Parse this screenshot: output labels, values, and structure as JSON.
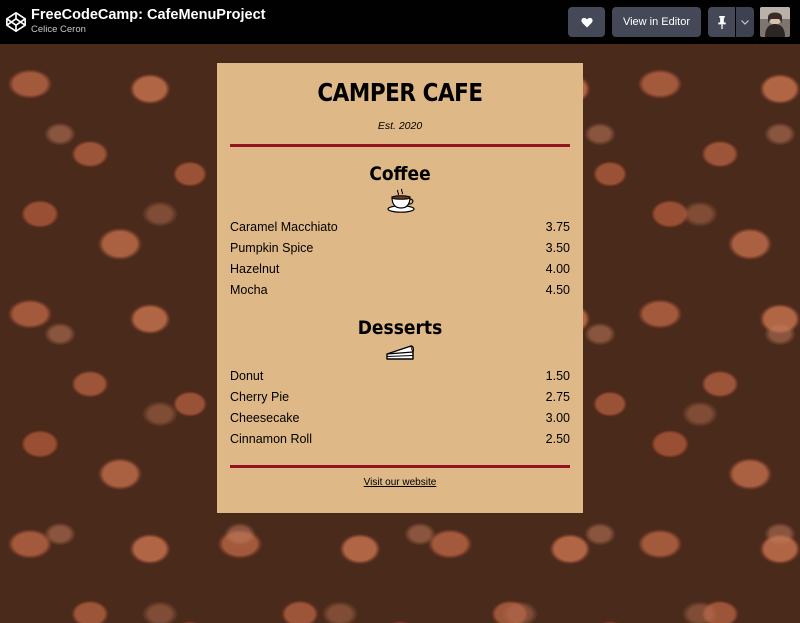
{
  "header": {
    "title": "FreeCodeCamp: CafeMenuProject",
    "author": "Celice Ceron",
    "editor_button": "View in Editor",
    "logo_icon": "codepen-icon",
    "heart_icon": "heart-icon",
    "pin_icon": "pin-icon",
    "dropdown_icon": "chevron-down-icon"
  },
  "menu": {
    "cafe_name": "CAMPER CAFE",
    "established": "Est. 2020",
    "coffee": {
      "title": "Coffee",
      "icon": "coffee-cup-icon",
      "items": [
        {
          "name": "Caramel Macchiato",
          "price": "3.75"
        },
        {
          "name": "Pumpkin Spice",
          "price": "3.50"
        },
        {
          "name": "Hazelnut",
          "price": "4.00"
        },
        {
          "name": "Mocha",
          "price": "4.50"
        }
      ]
    },
    "desserts": {
      "title": "Desserts",
      "icon": "pie-slice-icon",
      "items": [
        {
          "name": "Donut",
          "price": "1.50"
        },
        {
          "name": "Cherry Pie",
          "price": "2.75"
        },
        {
          "name": "Cheesecake",
          "price": "3.00"
        },
        {
          "name": "Cinnamon Roll",
          "price": "2.50"
        }
      ]
    },
    "footer_link": "Visit our website"
  },
  "colors": {
    "topbar": "#010101",
    "button": "#444857",
    "menu_background": "#deb887",
    "divider": "#92141c"
  }
}
